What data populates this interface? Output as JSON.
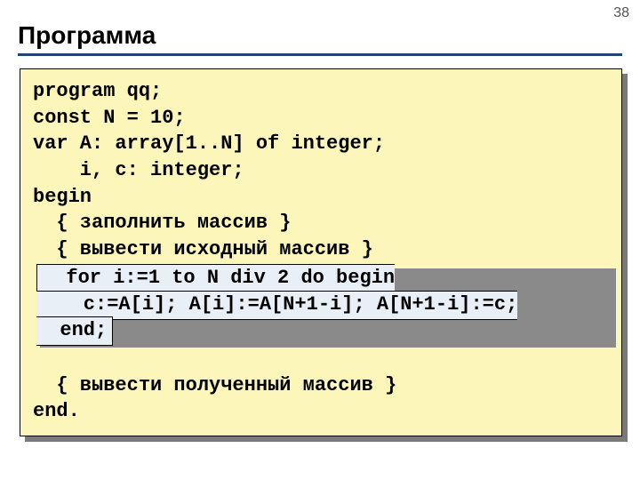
{
  "page_number": "38",
  "title": "Программа",
  "code": {
    "l1": "program qq;",
    "l2": "const N = 10;",
    "l3": "var A: array[1..N] of integer;",
    "l4": "    i, c: integer;",
    "l5": "begin",
    "l6": "  { заполнить массив }",
    "l7": "  { вывести исходный массив }",
    "hl1": "  for i:=1 to N div 2 do begin",
    "hl2": "    c:=A[i]; A[i]:=A[N+1-i]; A[N+1-i]:=c;",
    "hl3": "  end;",
    "l8": "  { вывести полученный массив }",
    "l9": "end."
  }
}
